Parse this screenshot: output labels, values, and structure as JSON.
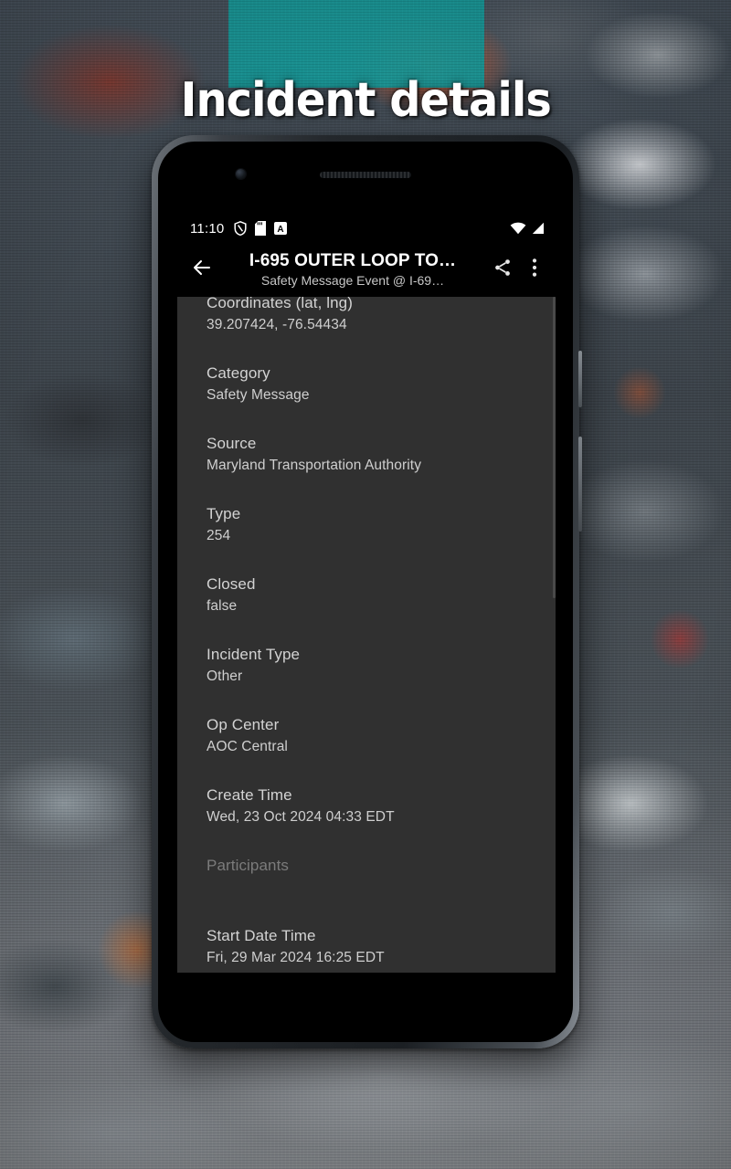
{
  "banner": {
    "headline": "Incident details"
  },
  "phone": {
    "status_bar": {
      "time": "11:10",
      "left_icons": [
        "shield-icon",
        "sd-card-icon",
        "letter-a-icon"
      ],
      "right_icons": [
        "wifi-icon",
        "cell-signal-icon"
      ]
    },
    "app_bar": {
      "back_icon": "arrow-back-icon",
      "title": "I-695 OUTER LOOP TO…",
      "subtitle": "Safety Message Event @ I-69…",
      "share_icon": "share-icon",
      "overflow_icon": "more-vert-icon"
    },
    "details": [
      {
        "label": "Coordinates (lat, lng)",
        "value": "39.207424, -76.54434",
        "dim": false
      },
      {
        "label": "Category",
        "value": "Safety Message",
        "dim": false
      },
      {
        "label": "Source",
        "value": "Maryland Transportation Authority",
        "dim": false
      },
      {
        "label": "Type",
        "value": "254",
        "dim": false
      },
      {
        "label": "Closed",
        "value": "false",
        "dim": false
      },
      {
        "label": "Incident Type",
        "value": "Other",
        "dim": false
      },
      {
        "label": "Op Center",
        "value": "AOC Central",
        "dim": false
      },
      {
        "label": "Create Time",
        "value": "Wed, 23 Oct 2024 04:33 EDT",
        "dim": false
      },
      {
        "label": "Participants",
        "value": "",
        "dim": true
      },
      {
        "label": "Start Date Time",
        "value": "Fri, 29 Mar 2024 16:25 EDT",
        "dim": false
      }
    ],
    "nav": {
      "gesture_pill": "home-gesture-pill"
    }
  },
  "colors": {
    "app_bar_bg": "#000000",
    "content_bg": "#303030",
    "label_text": "#d3d3d3",
    "value_text": "#cfcfcf",
    "dim_text": "#7b7b7b",
    "banner_text": "#ffffff"
  }
}
